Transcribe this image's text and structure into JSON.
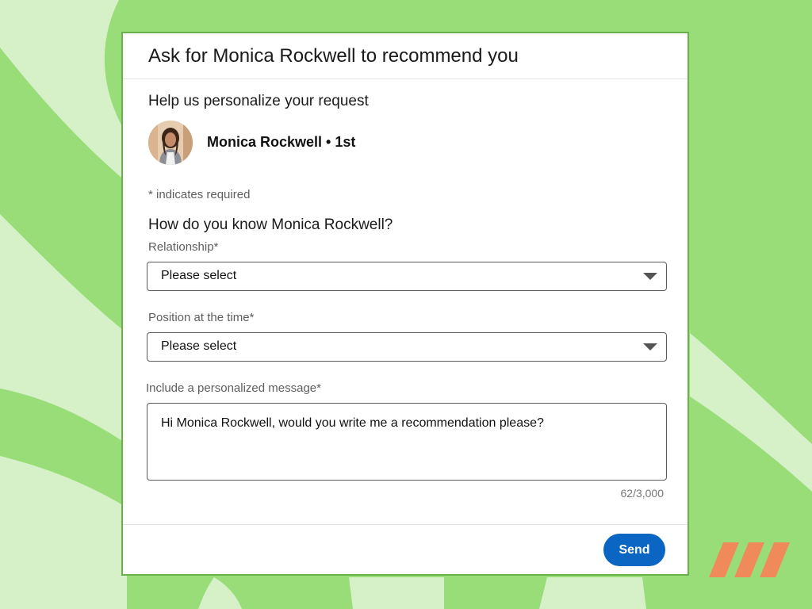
{
  "dialog": {
    "title": "Ask for Monica Rockwell to recommend you",
    "subtitle": "Help us personalize your request",
    "person": {
      "name": "Monica Rockwell • 1st",
      "avatar_icon": "profile-photo"
    },
    "required_note": "* indicates required",
    "question": "How do you know Monica Rockwell?",
    "relationship": {
      "label": "Relationship*",
      "value": "Please select"
    },
    "position": {
      "label": "Position at the time*",
      "value": "Please select"
    },
    "message": {
      "label": "Include a personalized message*",
      "value": "Hi Monica Rockwell, would you write me a recommendation please?",
      "count": "62/3,000"
    },
    "send_label": "Send"
  },
  "colors": {
    "background": "#98dd78",
    "background_light": "#d6f0c8",
    "modal_border": "#6ab04c",
    "send_button": "#0a66c2",
    "brand_mark": "#f08a5a"
  }
}
